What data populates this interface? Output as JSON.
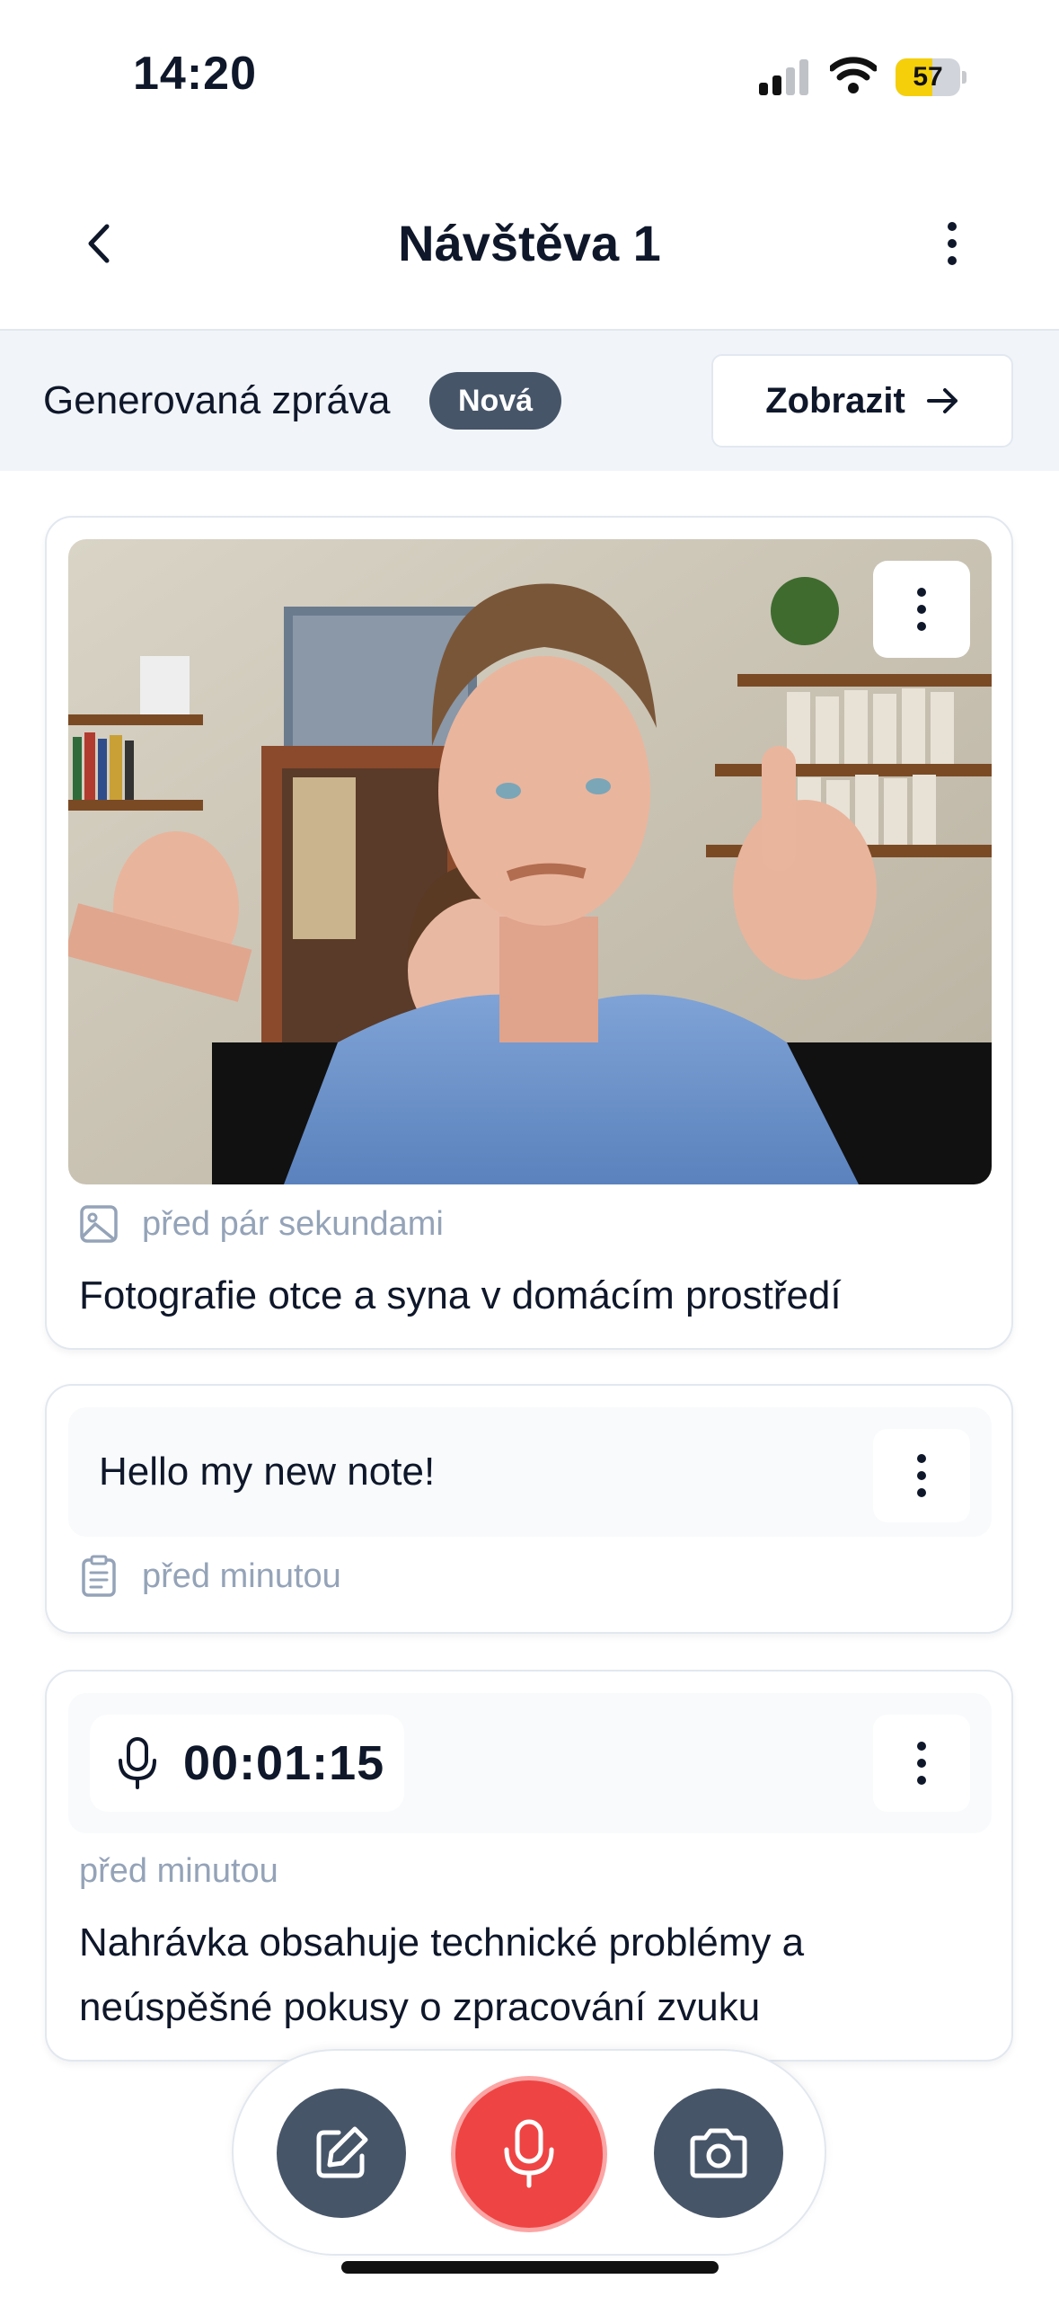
{
  "status_bar": {
    "time": "14:20",
    "battery": "57",
    "battery_level": 0.57,
    "signal_icon": "cellular-signal-icon",
    "wifi_icon": "wifi-icon"
  },
  "nav": {
    "title": "Návštěva 1",
    "back_icon": "chevron-left-icon",
    "more_icon": "more-vertical-icon"
  },
  "banner": {
    "label": "Generovaná zpráva",
    "badge": "Nová",
    "button_label": "Zobrazit"
  },
  "cards": {
    "photo": {
      "time": "před pár sekundami",
      "caption": "Fotografie otce a syna v domácím prostředí"
    },
    "note": {
      "text": "Hello my new note!",
      "time": "před minutou"
    },
    "recording": {
      "duration": "00:01:15",
      "time": "před minutou",
      "summary_line1": "Nahrávka obsahuje technické problémy a",
      "summary_line2": "neúspěšné pokusy o zpracování zvuku"
    }
  },
  "actions": {
    "note_icon": "edit-note-icon",
    "record_icon": "microphone-icon",
    "camera_icon": "camera-icon"
  },
  "colors": {
    "accent_dark": "#475569",
    "record_red": "#ef4444",
    "battery_yellow": "#f5cf0a",
    "muted_text": "#94a3b8"
  }
}
